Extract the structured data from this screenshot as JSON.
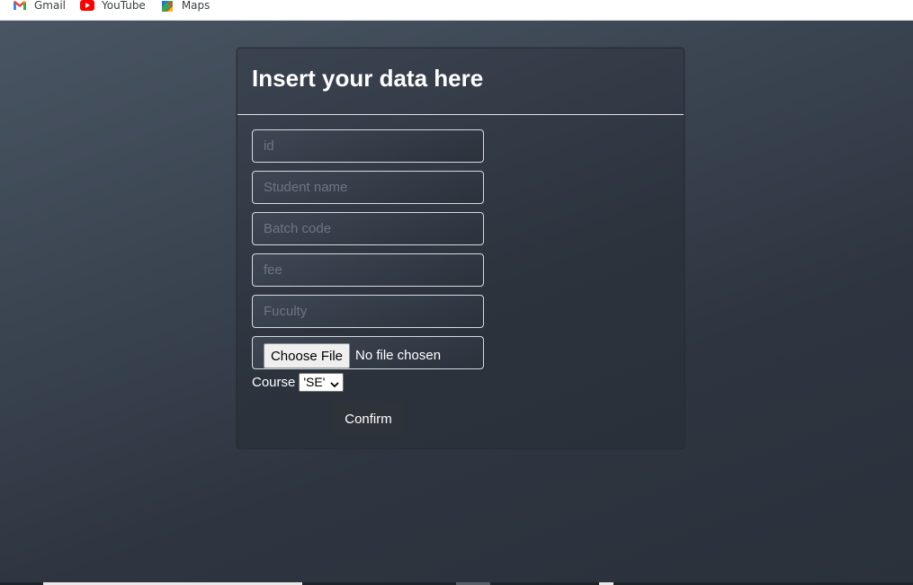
{
  "bookmarks": [
    {
      "label": "Gmail",
      "icon": "gmail-icon"
    },
    {
      "label": "YouTube",
      "icon": "youtube-icon"
    },
    {
      "label": "Maps",
      "icon": "maps-icon"
    }
  ],
  "form": {
    "title": "Insert your data here",
    "fields": [
      {
        "placeholder": "id",
        "value": ""
      },
      {
        "placeholder": "Student name",
        "value": ""
      },
      {
        "placeholder": "Batch code",
        "value": ""
      },
      {
        "placeholder": "fee",
        "value": ""
      },
      {
        "placeholder": "Fuculty",
        "value": ""
      }
    ],
    "file": {
      "button_label": "Choose File",
      "status": "No file chosen"
    },
    "course": {
      "label": "Course",
      "selected": "'SE'"
    },
    "submit_label": "Confirm"
  },
  "colors": {
    "accent_text": "#ffffff",
    "field_border": "#d7dbe0",
    "background": "#2f3640"
  }
}
